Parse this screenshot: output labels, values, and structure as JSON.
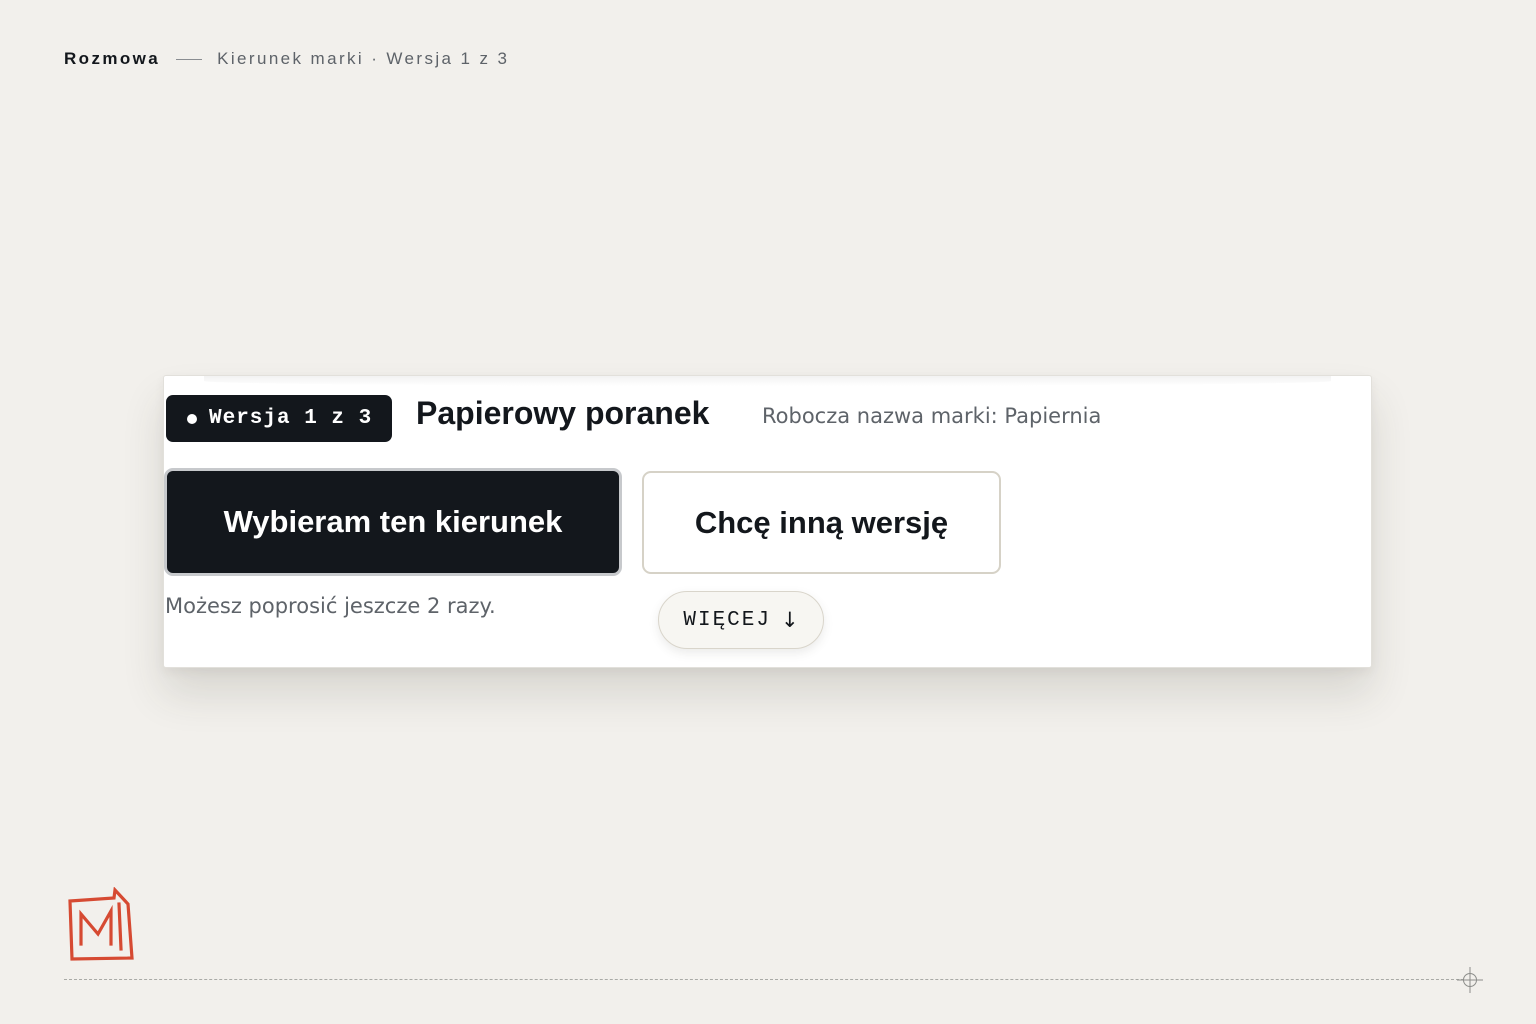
{
  "header": {
    "section": "Rozmowa",
    "current": "Kierunek marki · Wersja 1 z 3"
  },
  "card": {
    "badge_label": "Wersja 1 z 3",
    "title": "Papierowy poranek",
    "subtitle": "Robocza nazwa marki: Papiernia",
    "primary_button": "Wybieram ten kierunek",
    "secondary_button": "Chcę inną wersję",
    "hint": "Możesz poprosić jeszcze 2 razy.",
    "more_label": "WIĘCEJ",
    "more_arrow": "↓"
  },
  "logo": {
    "icon": "brand-m-logo",
    "color": "#d64a32"
  },
  "colors": {
    "background": "#f2f0ec",
    "ink": "#13171c",
    "muted": "#5e6369",
    "card": "#ffffff"
  }
}
